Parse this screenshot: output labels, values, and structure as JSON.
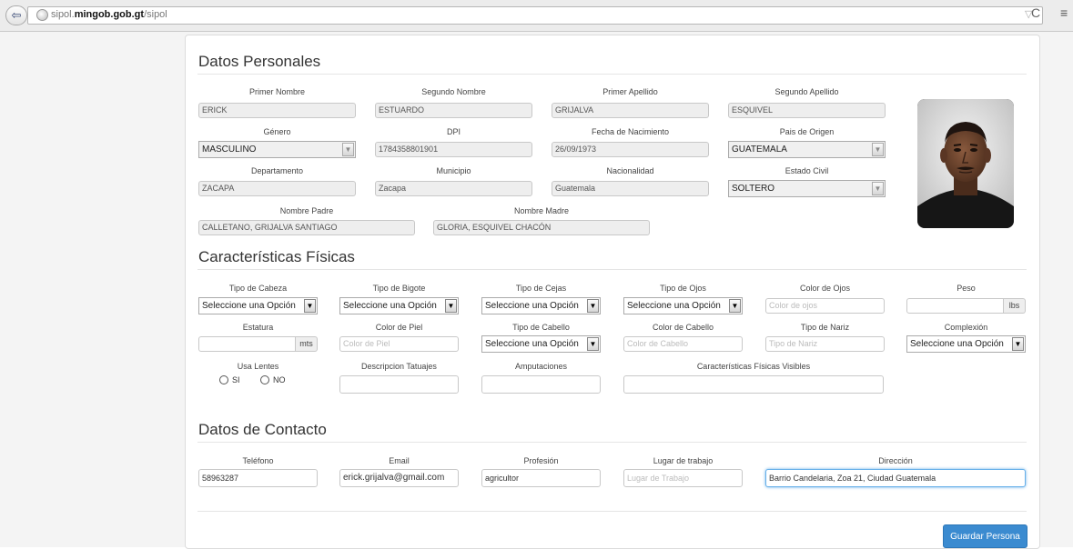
{
  "browser": {
    "url_prefix": "sipol.",
    "url_domain": "mingob.gob.gt",
    "url_path": "/sipol",
    "back_icon": "⇦",
    "star_icon": "▽",
    "reload_icon": "C",
    "menu_icon": "≡"
  },
  "personal": {
    "title": "Datos Personales",
    "labels": {
      "primer_nombre": "Primer Nombre",
      "segundo_nombre": "Segundo Nombre",
      "primer_apellido": "Primer Apellido",
      "segundo_apellido": "Segundo Apellido",
      "genero": "Género",
      "dpi": "DPI",
      "fecha_nacimiento": "Fecha de Nacimiento",
      "pais_origen": "Pais de Origen",
      "departamento": "Departamento",
      "municipio": "Municipio",
      "nacionalidad": "Nacionalidad",
      "estado_civil": "Estado Civil",
      "nombre_padre": "Nombre Padre",
      "nombre_madre": "Nombre Madre"
    },
    "values": {
      "primer_nombre": "ERICK",
      "segundo_nombre": "ESTUARDO",
      "primer_apellido": "GRIJALVA",
      "segundo_apellido": "ESQUIVEL",
      "genero": "MASCULINO",
      "dpi": "1784358801901",
      "fecha_nacimiento": "26/09/1973",
      "pais_origen": "GUATEMALA",
      "departamento": "ZACAPA",
      "municipio": "Zacapa",
      "nacionalidad": "Guatemala",
      "estado_civil": "SOLTERO",
      "nombre_padre": "CALLETANO, GRIJALVA SANTIAGO",
      "nombre_madre": "GLORIA, ESQUIVEL CHACÓN"
    }
  },
  "fisicas": {
    "title": "Características Físicas",
    "labels": {
      "tipo_cabeza": "Tipo de Cabeza",
      "tipo_bigote": "Tipo de Bigote",
      "tipo_cejas": "Tipo de Cejas",
      "tipo_ojos": "Tipo de Ojos",
      "color_ojos": "Color de Ojos",
      "peso": "Peso",
      "estatura": "Estatura",
      "color_piel": "Color de Piel",
      "tipo_cabello": "Tipo de Cabello",
      "color_cabello": "Color de Cabello",
      "tipo_nariz": "Tipo de Nariz",
      "complexion": "Complexión",
      "usa_lentes": "Usa Lentes",
      "tatuajes": "Descripcion Tatuajes",
      "amputaciones": "Amputaciones",
      "visibles": "Características Físicas Visibles"
    },
    "select_default": "Seleccione una Opción",
    "placeholders": {
      "color_ojos": "Color de ojos",
      "color_piel": "Color de Piel",
      "color_cabello": "Color de Cabello",
      "tipo_nariz": "Tipo de Nariz"
    },
    "units": {
      "peso": "lbs",
      "estatura": "mts"
    },
    "lentes_options": {
      "si": "SI",
      "no": "NO"
    }
  },
  "contacto": {
    "title": "Datos de Contacto",
    "labels": {
      "telefono": "Teléfono",
      "email": "Email",
      "profesion": "Profesión",
      "lugar_trabajo": "Lugar de trabajo",
      "direccion": "Dirección"
    },
    "values": {
      "telefono": "58963287",
      "email": "erick.grijalva@gmail.com",
      "profesion": "agricultor",
      "direccion": "Barrio Candelaria, Zoa 21, Ciudad Guatemala"
    },
    "placeholders": {
      "lugar_trabajo": "Lugar de Trabajo"
    }
  },
  "actions": {
    "save_label": "Guardar Persona"
  },
  "arrow_glyph": "▼"
}
